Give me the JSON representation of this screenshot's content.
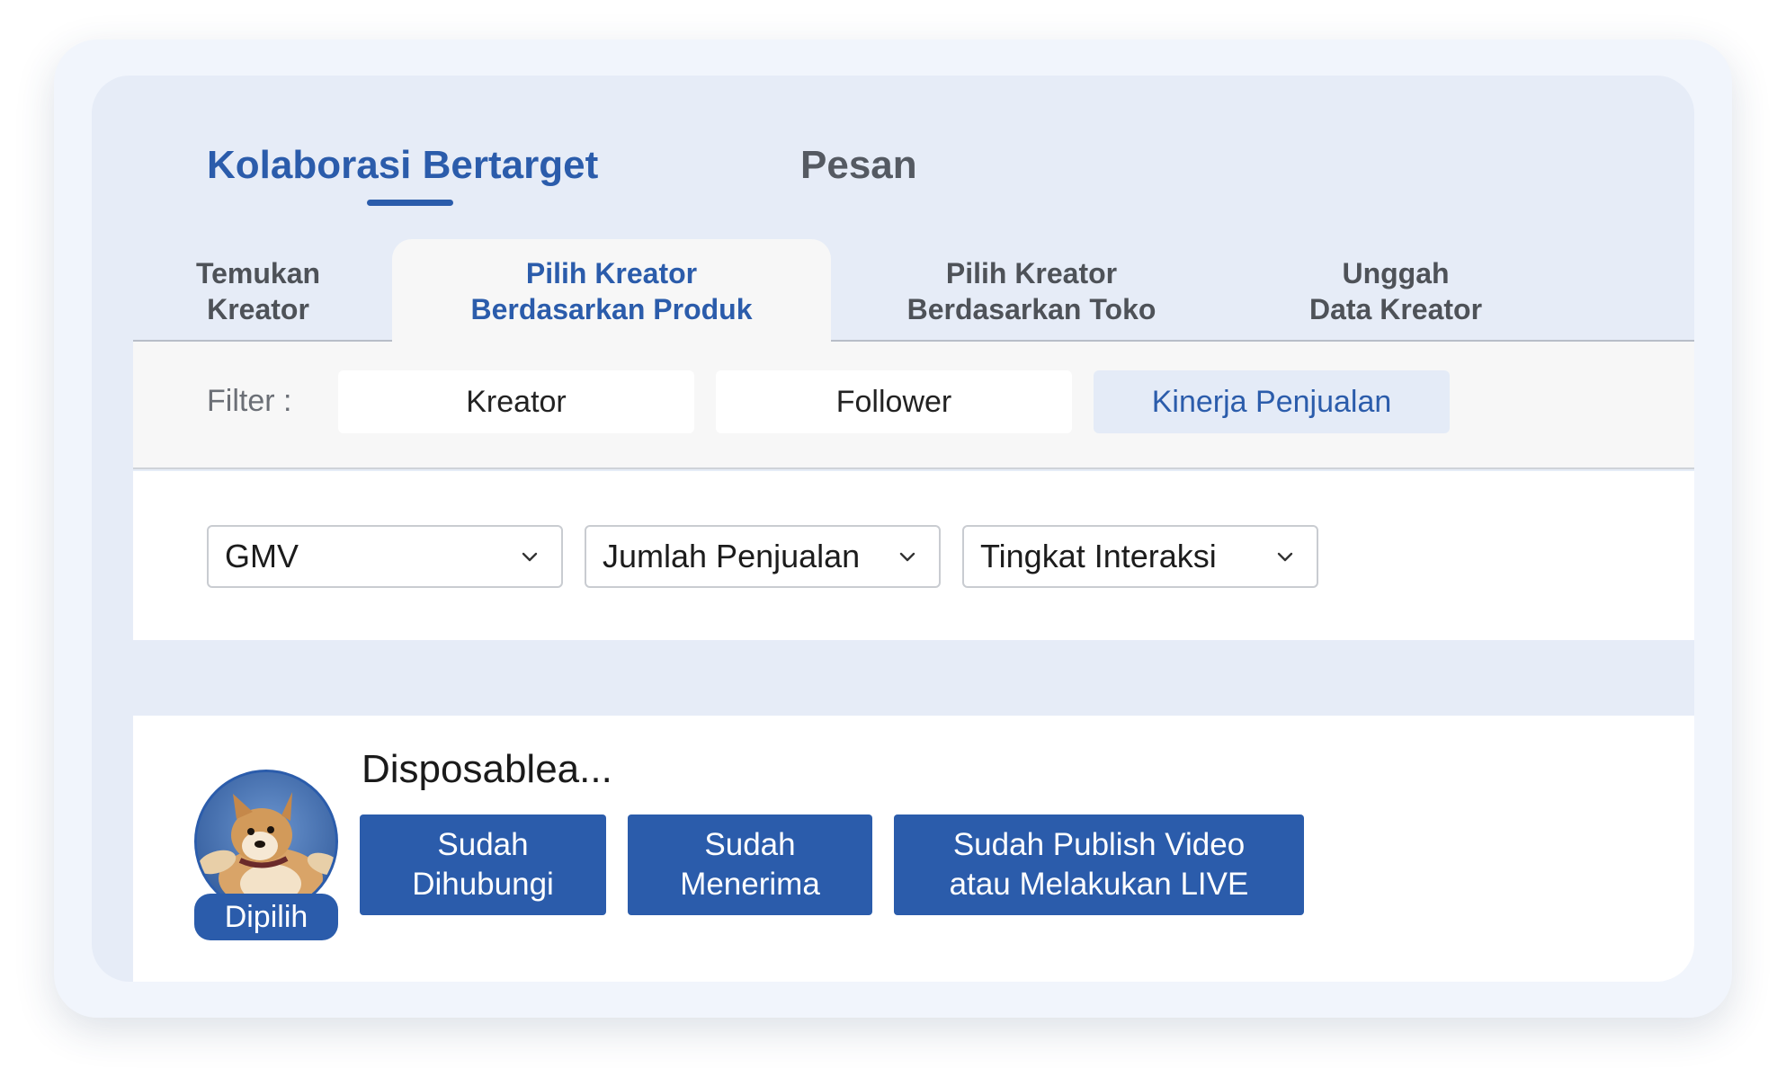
{
  "top_tabs": [
    {
      "label": "Kolaborasi Bertarget",
      "active": true
    },
    {
      "label": "Pesan",
      "active": false
    }
  ],
  "sub_tabs": [
    {
      "line1": "Temukan",
      "line2": "Kreator"
    },
    {
      "line1": "Pilih Kreator",
      "line2": "Berdasarkan Produk"
    },
    {
      "line1": "Pilih Kreator",
      "line2": "Berdasarkan Toko"
    },
    {
      "line1": "Unggah",
      "line2": "Data Kreator"
    }
  ],
  "filter": {
    "label": "Filter :",
    "chips": [
      "Kreator",
      "Follower",
      "Kinerja Penjualan"
    ],
    "active_chip": "Kinerja Penjualan"
  },
  "dropdowns": [
    "GMV",
    "Jumlah Penjualan",
    "Tingkat Interaksi"
  ],
  "creator": {
    "name": "Disposablea...",
    "badge": "Dipilih",
    "statuses": [
      {
        "line1": "Sudah",
        "line2": "Dihubungi"
      },
      {
        "line1": "Sudah",
        "line2": "Menerima"
      },
      {
        "line1": "Sudah Publish Video",
        "line2": "atau Melakukan LIVE"
      }
    ]
  },
  "colors": {
    "accent": "#2b5cab",
    "panel_bg": "#e6ecf7",
    "card_bg": "#f1f5fc"
  },
  "icons": {
    "dropdown": "chevron-down-icon",
    "avatar": "dog-photo"
  }
}
